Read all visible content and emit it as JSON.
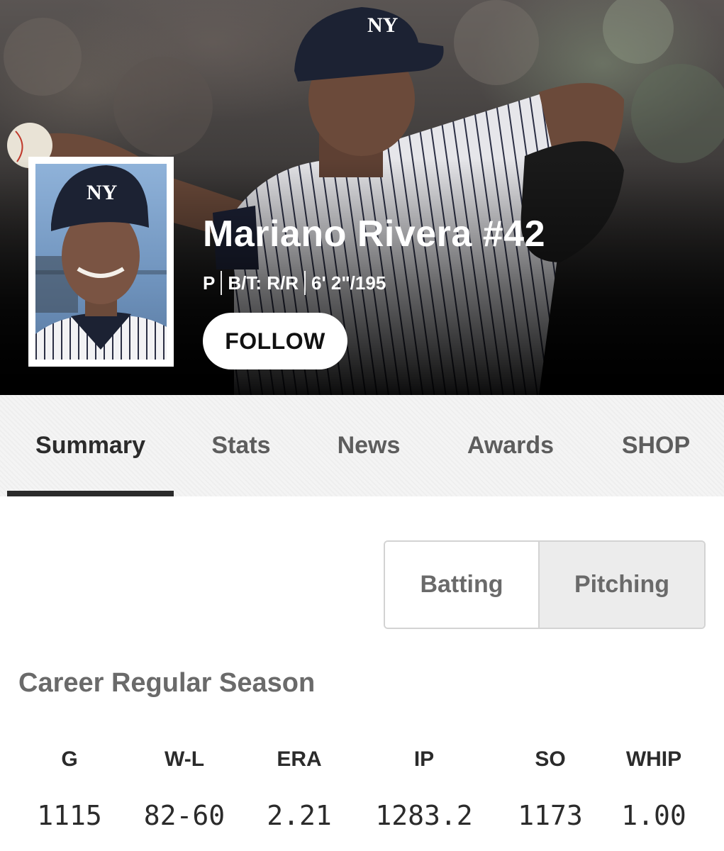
{
  "player": {
    "name": "Mariano Rivera #42",
    "position": "P",
    "bats_throws": "B/T: R/R",
    "height_weight": "6' 2\"/195"
  },
  "follow_label": "FOLLOW",
  "tabs": [
    {
      "label": "Summary",
      "active": true
    },
    {
      "label": "Stats",
      "active": false
    },
    {
      "label": "News",
      "active": false
    },
    {
      "label": "Awards",
      "active": false
    },
    {
      "label": "SHOP",
      "active": false
    }
  ],
  "toggle": {
    "batting_label": "Batting",
    "pitching_label": "Pitching",
    "selected": "Pitching"
  },
  "career": {
    "title": "Career Regular Season",
    "headers": [
      "G",
      "W-L",
      "ERA",
      "IP",
      "SO",
      "WHIP"
    ],
    "values": [
      "1115",
      "82-60",
      "2.21",
      "1283.2",
      "1173",
      "1.00"
    ]
  }
}
